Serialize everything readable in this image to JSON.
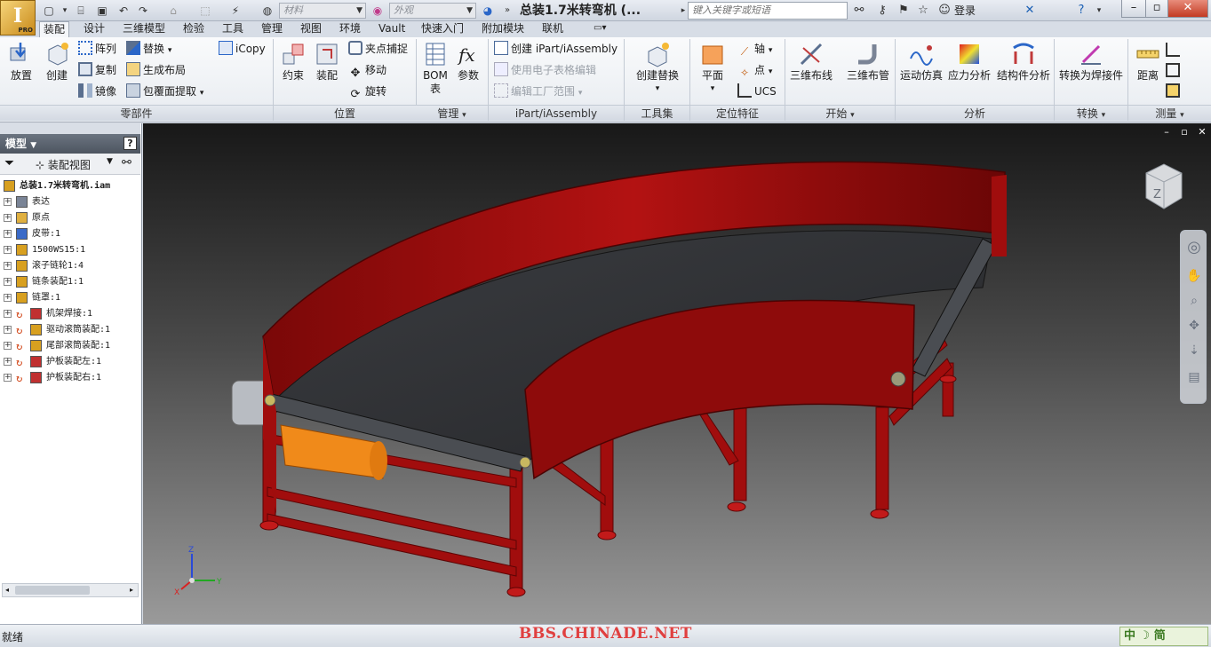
{
  "app": {
    "logo_letter": "I",
    "edition": "PRO"
  },
  "quick_access": {
    "material_placeholder": "材料",
    "appearance_placeholder": "外观"
  },
  "title": "总装1.7米转弯机 (...",
  "search": {
    "placeholder": "键入关键字或短语"
  },
  "user": {
    "login_label": "登录"
  },
  "tabs": [
    "装配",
    "设计",
    "三维模型",
    "检验",
    "工具",
    "管理",
    "视图",
    "环境",
    "Vault",
    "快速入门",
    "附加模块",
    "联机"
  ],
  "active_tab": "装配",
  "ribbon": {
    "component": {
      "label": "零部件",
      "place": "放置",
      "create": "创建",
      "pattern": "阵列",
      "copy": "复制",
      "mirror": "镜像",
      "replace": "替换",
      "gen_layout": "生成布局",
      "shrinkwrap": "包覆面提取",
      "icopy": "iCopy"
    },
    "position": {
      "label": "位置",
      "constrain": "约束",
      "assemble": "装配",
      "grip_snap": "夹点捕捉",
      "move": "移动",
      "rotate": "旋转"
    },
    "manage": {
      "label": "管理",
      "bom_line1": "BOM",
      "bom_line2": "表",
      "params": "参数"
    },
    "ipart": {
      "label": "iPart/iAssembly",
      "create": "创建 iPart/iAssembly",
      "edit_spreadsheet": "使用电子表格编辑",
      "edit_factory": "编辑工厂范围"
    },
    "productivity": {
      "label": "工具集",
      "create_substitute": "创建替换"
    },
    "work_features": {
      "label": "定位特征",
      "plane": "平面",
      "axis": "轴",
      "point": "点",
      "ucs": "UCS"
    },
    "begin": {
      "label": "开始",
      "route": "三维布线",
      "tube_pipe": "三维布管"
    },
    "analysis": {
      "label": "分析",
      "dynamic_sim": "运动仿真",
      "stress": "应力分析",
      "frame": "结构件分析"
    },
    "convert": {
      "label": "转换",
      "to_weldment": "转换为焊接件"
    },
    "measure": {
      "label": "测量",
      "distance": "距离"
    }
  },
  "browser": {
    "title": "模型",
    "view_label": "装配视图",
    "tree": [
      {
        "label": "总装1.7米转弯机.iam",
        "root": true
      },
      {
        "label": "表达"
      },
      {
        "label": "原点"
      },
      {
        "label": "皮带:1"
      },
      {
        "label": "1500WS15:1"
      },
      {
        "label": "滚子链轮1:4"
      },
      {
        "label": "链条装配1:1"
      },
      {
        "label": "链罩:1"
      },
      {
        "label": "机架焊接:1"
      },
      {
        "label": "驱动滚筒装配:1"
      },
      {
        "label": "尾部滚筒装配:1"
      },
      {
        "label": "护板装配左:1"
      },
      {
        "label": "护板装配右:1"
      }
    ]
  },
  "axis_labels": {
    "x": "X",
    "y": "Y",
    "z": "Z"
  },
  "status": {
    "text": "就绪",
    "watermark": "BBS.CHINADE.NET",
    "ime": "中 ☽ 简"
  },
  "colors": {
    "frame_red": "#9a0a0a",
    "belt": "#2e2f31",
    "motor": "#f08a1a"
  }
}
